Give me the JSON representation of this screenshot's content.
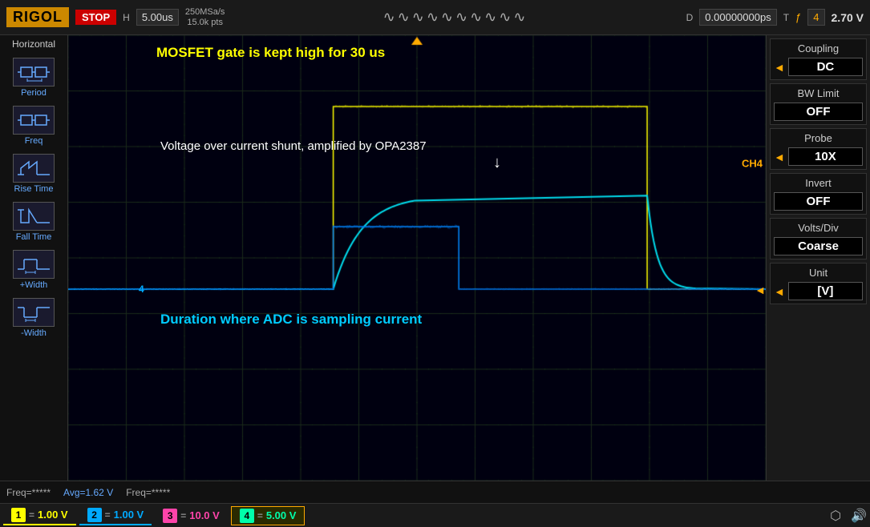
{
  "topbar": {
    "logo": "RIGOL",
    "stop_label": "STOP",
    "h_label": "H",
    "timebase": "5.00us",
    "sample_rate": "250MSa/s",
    "pts": "15.0k pts",
    "trigger_wave": "∿∿∿∿∿∿∿∿∿∿",
    "d_label": "D",
    "delay": "0.00000000ps",
    "t_label": "T",
    "trig_num": "4",
    "voltage": "2.70 V"
  },
  "sidebar_left": {
    "title": "Horizontal",
    "items": [
      {
        "label": "Period",
        "icon": "period"
      },
      {
        "label": "Freq",
        "icon": "freq"
      },
      {
        "label": "Rise Time",
        "icon": "rise"
      },
      {
        "label": "Fall Time",
        "icon": "fall"
      },
      {
        "+Width": "+Width",
        "icon": "plus-width"
      },
      {
        "-Width": "-Width",
        "icon": "minus-width"
      }
    ]
  },
  "display": {
    "annotation1": "MOSFET gate is kept high for 30 us",
    "annotation2": "Voltage over current shunt, amplified by OPA2387",
    "annotation3": "Duration where ADC is sampling current",
    "ch4_label": "CH4"
  },
  "status_bar": {
    "freq1": "Freq=*****",
    "avg": "Avg=1.62 V",
    "freq2": "Freq=*****"
  },
  "channel_bar": {
    "channels": [
      {
        "num": "1",
        "eq": "=",
        "val": "1.00 V",
        "color": "#ffff00"
      },
      {
        "num": "2",
        "eq": "=",
        "val": "1.00 V",
        "color": "#00aaff"
      },
      {
        "num": "3",
        "eq": "=",
        "val": "10.0 V",
        "color": "#ff44aa"
      },
      {
        "num": "4",
        "eq": "=",
        "val": "5.00 V",
        "color": "#00ffaa"
      }
    ]
  },
  "right_sidebar": {
    "coupling": {
      "title": "Coupling",
      "value": "DC"
    },
    "bw_limit": {
      "title": "BW Limit",
      "value": "OFF"
    },
    "probe": {
      "title": "Probe",
      "value": "10X"
    },
    "invert": {
      "title": "Invert",
      "value": "OFF"
    },
    "volts_div": {
      "title": "Volts/Div",
      "value": "Coarse"
    },
    "unit": {
      "title": "Unit",
      "value": "[V]"
    }
  }
}
